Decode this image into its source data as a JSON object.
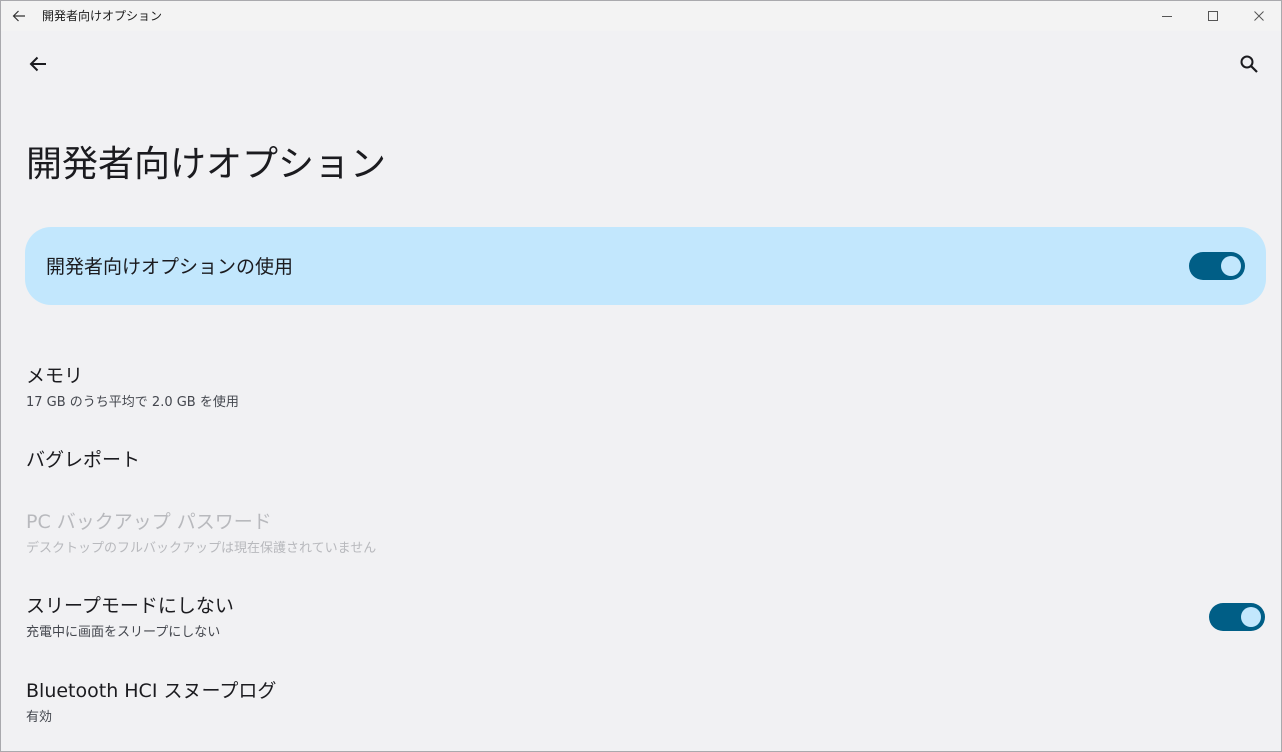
{
  "window": {
    "title": "開発者向けオプション",
    "controls": [
      "minimize",
      "maximize",
      "close"
    ]
  },
  "appbar": {
    "back_icon": "arrow-left-icon",
    "search_icon": "search-icon"
  },
  "page_title": "開発者向けオプション",
  "main_switch": {
    "label": "開発者向けオプションの使用",
    "checked": true
  },
  "items": [
    {
      "title": "メモリ",
      "subtitle": "17 GB のうち平均で 2.0 GB を使用",
      "enabled": true
    },
    {
      "title": "バグレポート",
      "enabled": true
    },
    {
      "title": "PC バックアップ パスワード",
      "subtitle": "デスクトップのフルバックアップは現在保護されていません",
      "enabled": false
    },
    {
      "title": "スリープモードにしない",
      "subtitle": "充電中に画面をスリープにしない",
      "enabled": true,
      "switch_checked": true
    },
    {
      "title": "Bluetooth HCI スヌープログ",
      "subtitle": "有効",
      "enabled": true
    }
  ],
  "colors": {
    "background": "#f1f1f3",
    "card": "#c2e7fd",
    "switch_track": "#005e86",
    "switch_thumb": "#c2e7fd",
    "disabled_text": "#b8b9bd"
  }
}
